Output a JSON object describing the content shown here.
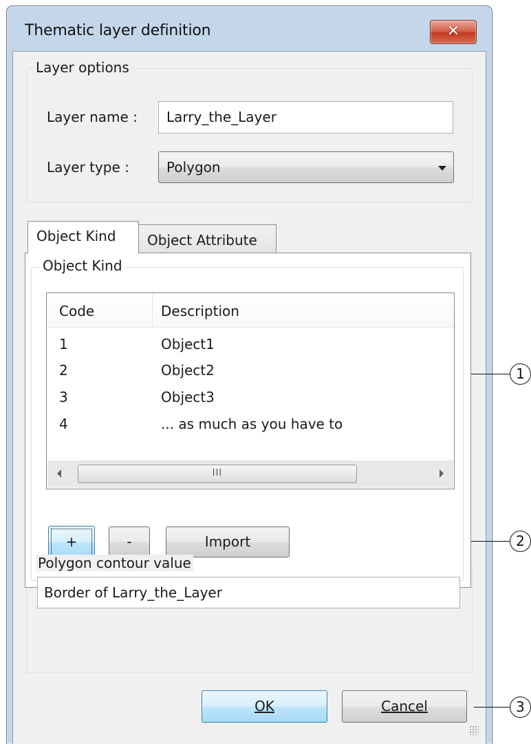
{
  "window": {
    "title": "Thematic layer definition",
    "close_icon": "close-icon"
  },
  "layer_options": {
    "legend": "Layer options",
    "name_label": "Layer name :",
    "name_value": "Larry_the_Layer",
    "type_label": "Layer type :",
    "type_value": "Polygon"
  },
  "tabs": [
    {
      "label": "Object Kind",
      "active": true
    },
    {
      "label": "Object Attribute",
      "active": false
    }
  ],
  "object_kind": {
    "legend": "Object Kind",
    "columns": [
      "Code",
      "Description"
    ],
    "rows": [
      {
        "code": "1",
        "description": "Object1"
      },
      {
        "code": "2",
        "description": "Object2"
      },
      {
        "code": "3",
        "description": "Object3"
      },
      {
        "code": "4",
        "description": "... as much as you have to"
      }
    ],
    "scroll_thumb_grip": "III",
    "buttons": {
      "add": "+",
      "remove": "-",
      "import": "Import"
    }
  },
  "polygon_contour": {
    "legend": "Polygon contour value",
    "value": "Border of Larry_the_Layer"
  },
  "footer": {
    "ok_label": "OK",
    "cancel_label": "Cancel"
  },
  "callouts": [
    "1",
    "2",
    "3"
  ],
  "colors": {
    "frame": "#c4d6ea",
    "close_button": "#c53a20",
    "default_button": "#bee6fd"
  }
}
